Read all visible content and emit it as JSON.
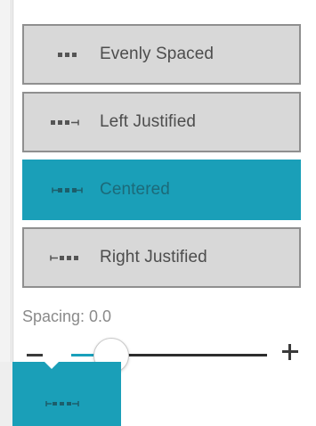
{
  "colors": {
    "accent": "#1a9fb8",
    "option_background": "#d8d8d8",
    "option_border": "#8f8f8f",
    "text": "#4d4d4d",
    "selected_text": "#1c6a79"
  },
  "alignment_options": [
    {
      "label": "Evenly Spaced",
      "icon": "evenly-spaced-icon",
      "selected": false
    },
    {
      "label": "Left Justified",
      "icon": "left-justified-icon",
      "selected": false
    },
    {
      "label": "Centered",
      "icon": "centered-icon",
      "selected": true
    },
    {
      "label": "Right Justified",
      "icon": "right-justified-icon",
      "selected": false
    }
  ],
  "spacing": {
    "label": "Spacing: 0.0",
    "minus_icon": "minus-icon",
    "plus_icon": "plus-icon",
    "slider_level": 0.2
  },
  "trigger": {
    "icon": "centered-icon"
  }
}
